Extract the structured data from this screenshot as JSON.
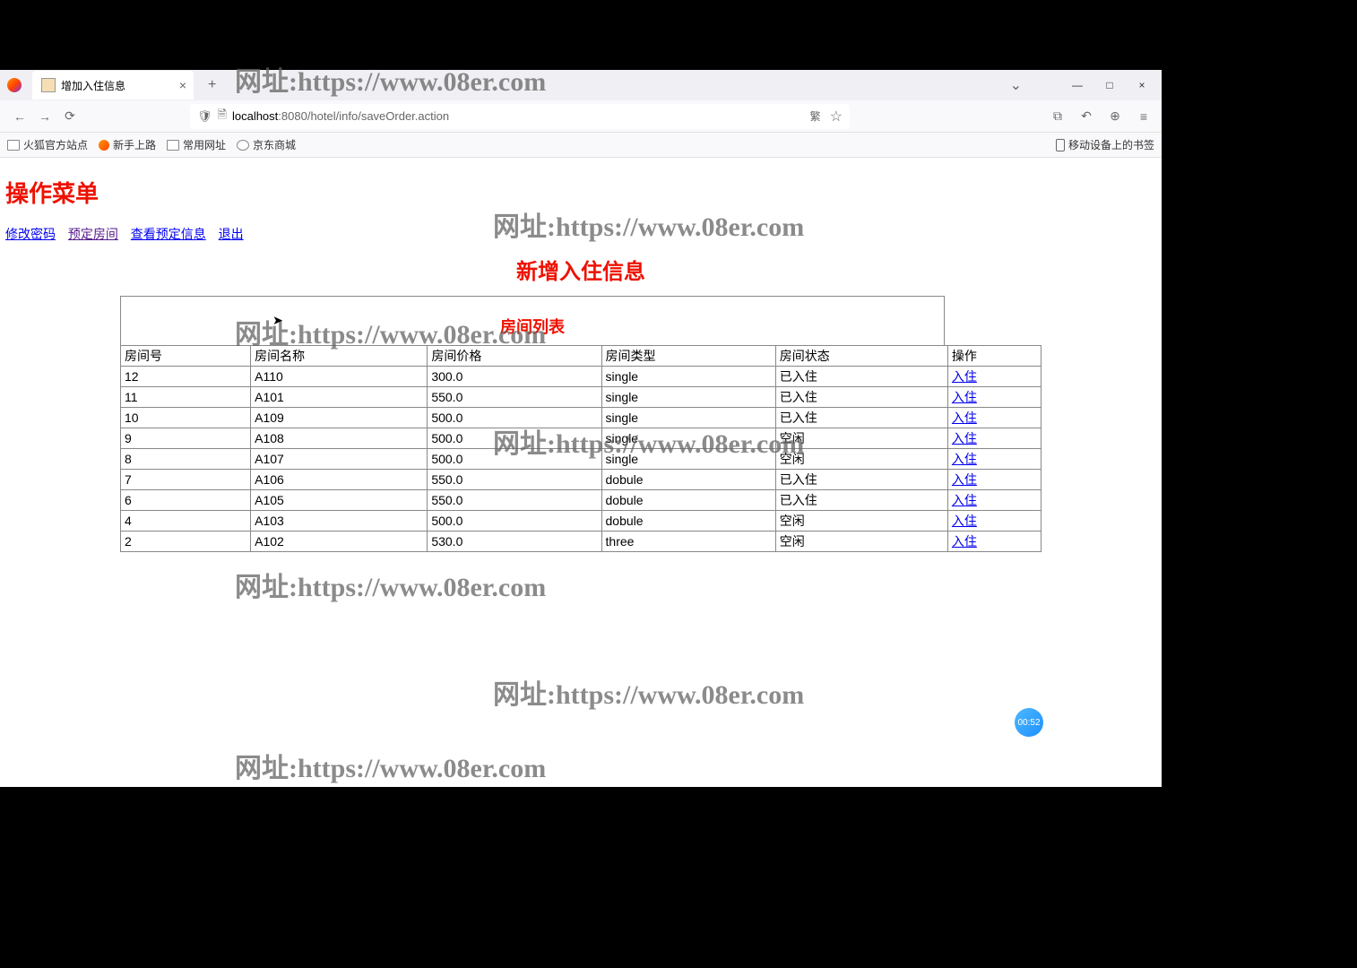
{
  "browser": {
    "tab_title": "增加入住信息",
    "url_host": "localhost",
    "url_port": ":8080",
    "url_path": "/hotel/info/saveOrder.action"
  },
  "bookmarks": {
    "items": [
      "火狐官方站点",
      "新手上路",
      "常用网址",
      "京东商城"
    ],
    "right": "移动设备上的书签"
  },
  "page": {
    "menu_title": "操作菜单",
    "links": {
      "change_pwd": "修改密码",
      "reserve": "预定房间",
      "view_reserve": "查看预定信息",
      "logout": "退出"
    },
    "page_heading": "新增入住信息",
    "list_heading": "房间列表"
  },
  "table": {
    "headers": [
      "房间号",
      "房间名称",
      "房间价格",
      "房间类型",
      "房间状态",
      "操作"
    ],
    "action_label": "入住",
    "rows": [
      {
        "id": "12",
        "name": "A110",
        "price": "300.0",
        "type": "single",
        "status": "已入住"
      },
      {
        "id": "11",
        "name": "A101",
        "price": "550.0",
        "type": "single",
        "status": "已入住"
      },
      {
        "id": "10",
        "name": "A109",
        "price": "500.0",
        "type": "single",
        "status": "已入住"
      },
      {
        "id": "9",
        "name": "A108",
        "price": "500.0",
        "type": "single",
        "status": "空闲"
      },
      {
        "id": "8",
        "name": "A107",
        "price": "500.0",
        "type": "single",
        "status": "空闲"
      },
      {
        "id": "7",
        "name": "A106",
        "price": "550.0",
        "type": "dobule",
        "status": "已入住"
      },
      {
        "id": "6",
        "name": "A105",
        "price": "550.0",
        "type": "dobule",
        "status": "已入住"
      },
      {
        "id": "4",
        "name": "A103",
        "price": "500.0",
        "type": "dobule",
        "status": "空闲"
      },
      {
        "id": "2",
        "name": "A102",
        "price": "530.0",
        "type": "three",
        "status": "空闲"
      }
    ]
  },
  "watermark": "网址:https://www.08er.com",
  "timer": "00:52"
}
